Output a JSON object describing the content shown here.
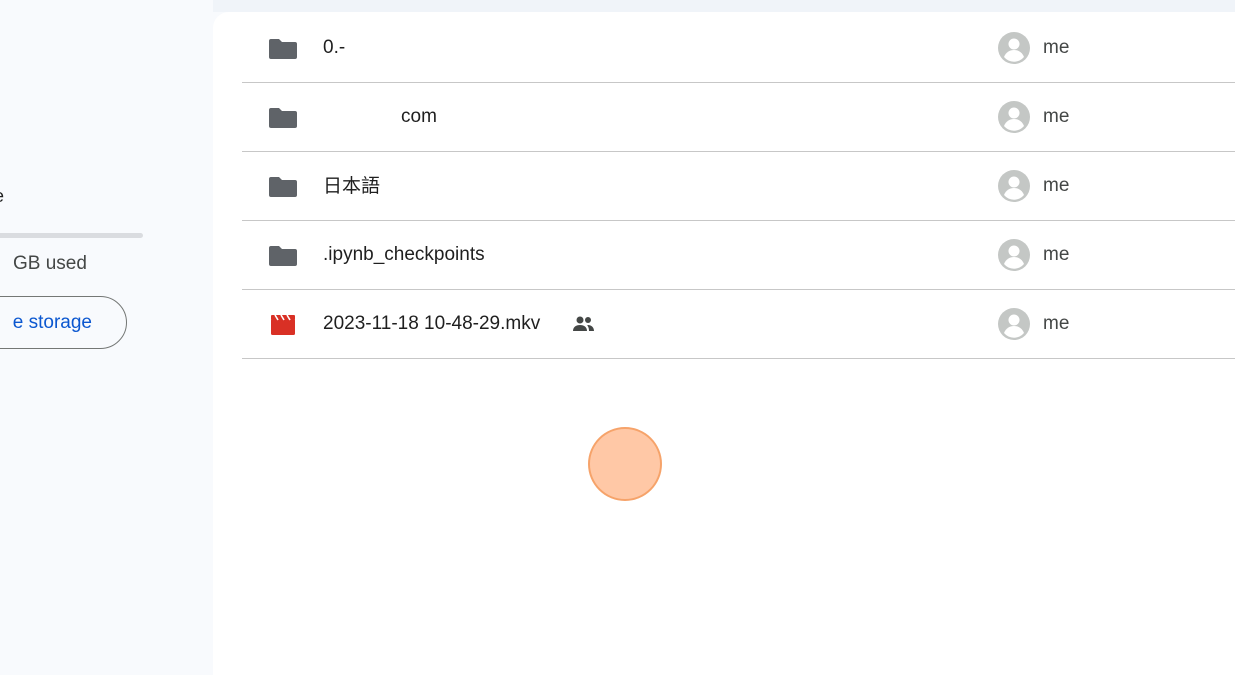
{
  "sidebar": {
    "storage_label": "e",
    "storage_used": "GB used",
    "get_storage_button": "e storage"
  },
  "files": [
    {
      "name": "0.-",
      "type": "folder",
      "owner": "me",
      "shared": false
    },
    {
      "name": "com",
      "type": "folder",
      "owner": "me",
      "shared": false
    },
    {
      "name": "日本語",
      "type": "folder",
      "owner": "me",
      "shared": false
    },
    {
      "name": ".ipynb_checkpoints",
      "type": "folder",
      "owner": "me",
      "shared": false
    },
    {
      "name": "2023-11-18 10-48-29.mkv",
      "type": "video",
      "owner": "me",
      "shared": true
    }
  ],
  "colors": {
    "folder_icon": "#5f6368",
    "video_icon": "#d93025",
    "avatar": "#c4c7c5",
    "link_blue": "#0b57d0",
    "cursor_highlight": "#ffbe96"
  },
  "icons": {
    "folder": "folder-icon",
    "video": "video-file-icon",
    "shared": "shared-people-icon",
    "owner": "account-circle-icon"
  }
}
